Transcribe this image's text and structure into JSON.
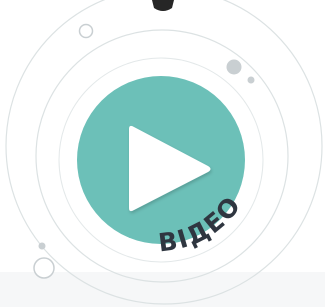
{
  "video_badge": {
    "label": "ВІДЕО",
    "colors": {
      "circle_fill": "#6CC0B8",
      "play_fill": "#FFFFFF",
      "label_color": "#2F3640",
      "orbit_line": "#DCE2E3",
      "node_fill": "#C9CFD2",
      "top_shape": "#262626",
      "floor_shade": "#EEF1F2"
    },
    "icons": {
      "play": "play-icon",
      "orbit_nodes": "orbit-node-icon"
    }
  }
}
